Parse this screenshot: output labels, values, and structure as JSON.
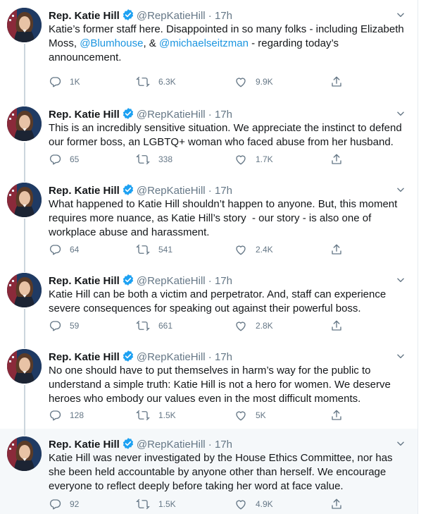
{
  "colors": {
    "accent": "#1b95e0",
    "muted": "#657786",
    "verified": "#1da1f2"
  },
  "tweets": [
    {
      "name": "Rep. Katie Hill",
      "handle": "@RepKatieHill",
      "dot": "·",
      "time": "17h",
      "text_parts": [
        "Katie’s former staff here. Disappointed in so many folks - including Elizabeth Moss, ",
        "@Blumhouse",
        ", & ",
        "@michaelseitzman",
        " - regarding today’s announcement."
      ],
      "replies": "1K",
      "retweets": "6.3K",
      "likes": "9.9K"
    },
    {
      "name": "Rep. Katie Hill",
      "handle": "@RepKatieHill",
      "dot": "·",
      "time": "17h",
      "text": "This is an incredibly sensitive situation. We appreciate the instinct to defend our former boss, an LGBTQ+ woman who faced abuse from her husband.",
      "replies": "65",
      "retweets": "338",
      "likes": "1.7K"
    },
    {
      "name": "Rep. Katie Hill",
      "handle": "@RepKatieHill",
      "dot": "·",
      "time": "17h",
      "text": "What happened to Katie Hill shouldn’t happen to anyone. But, this moment requires more nuance, as Katie Hill’s story  - our story - is also one of workplace abuse and harassment.",
      "replies": "64",
      "retweets": "541",
      "likes": "2.4K"
    },
    {
      "name": "Rep. Katie Hill",
      "handle": "@RepKatieHill",
      "dot": "·",
      "time": "17h",
      "text": "Katie Hill can be both a victim and perpetrator. And, staff can experience severe consequences for speaking out against their powerful boss.",
      "replies": "59",
      "retweets": "661",
      "likes": "2.8K"
    },
    {
      "name": "Rep. Katie Hill",
      "handle": "@RepKatieHill",
      "dot": "·",
      "time": "17h",
      "text": "No one should have to put themselves in harm’s way for the public to understand a simple truth: Katie Hill is not a hero for women. We deserve heroes who embody our values even in the most difficult moments.",
      "replies": "128",
      "retweets": "1.5K",
      "likes": "5K"
    },
    {
      "name": "Rep. Katie Hill",
      "handle": "@RepKatieHill",
      "dot": "·",
      "time": "17h",
      "text": "Katie Hill was never investigated by the House Ethics Committee, nor has she been held accountable by anyone other than herself. We encourage everyone to reflect deeply before taking her word at face value.",
      "replies": "92",
      "retweets": "1.5K",
      "likes": "4.9K"
    }
  ]
}
